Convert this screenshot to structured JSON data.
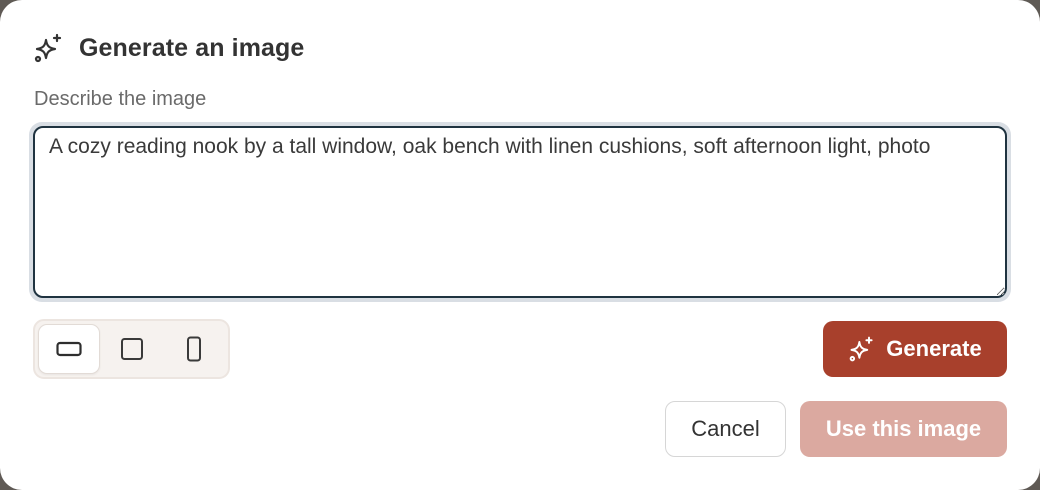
{
  "dialog": {
    "title": "Generate an image",
    "title_icon": "sparkles-icon"
  },
  "prompt": {
    "label": "Describe the image",
    "value": "A cozy reading nook by a tall window, oak bench with linen cushions, soft afternoon light, photo"
  },
  "aspect_ratio": {
    "options": [
      {
        "name": "landscape",
        "icon": "landscape-ratio-icon",
        "selected": true
      },
      {
        "name": "square",
        "icon": "square-ratio-icon",
        "selected": false
      },
      {
        "name": "portrait",
        "icon": "portrait-ratio-icon",
        "selected": false
      }
    ]
  },
  "actions": {
    "generate_label": "Generate",
    "cancel_label": "Cancel",
    "use_label": "Use this image",
    "use_enabled": false
  },
  "colors": {
    "primary": "#a8402c",
    "primary_disabled": "#dba9a0",
    "focus_border": "#1f3340",
    "focus_ring": "#d9dee4"
  }
}
